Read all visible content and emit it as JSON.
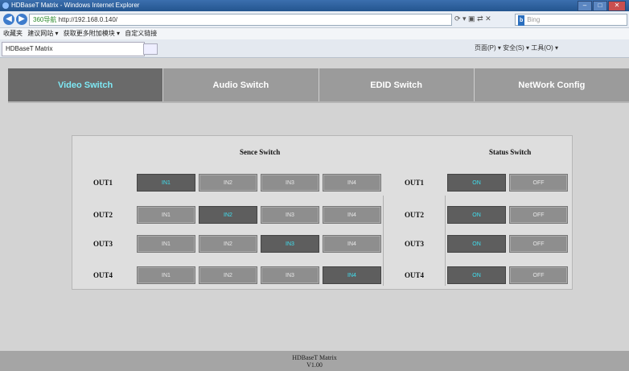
{
  "browser": {
    "window_title": "HDBaseT Matrix - Windows Internet Explorer",
    "url_prefix": "360导航",
    "url": "http://192.168.0.140/",
    "search_placeholder": "Bing",
    "search_engine_label": "Bing",
    "favorites_label": "收藏夹",
    "fav_links": [
      "建议网站 ▾",
      "获取更多附加模块 ▾",
      "自定义链接"
    ],
    "tab_title": "HDBaseT Matrix",
    "tools_text": "页面(P) ▾  安全(S) ▾  工具(O) ▾"
  },
  "nav": {
    "tabs": [
      "Video Switch",
      "Audio Switch",
      "EDID Switch",
      "NetWork Config"
    ],
    "active_index": 0
  },
  "panel": {
    "scene_header": "Sence Switch",
    "status_header": "Status Switch",
    "rows": [
      {
        "label": "OUT1",
        "active_input": 0,
        "status_label": "OUT1"
      },
      {
        "label": "OUT2",
        "active_input": 1,
        "status_label": "OUT2"
      },
      {
        "label": "OUT3",
        "active_input": 2,
        "status_label": "OUT3"
      },
      {
        "label": "OUT4",
        "active_input": 3,
        "status_label": "OUT4"
      }
    ],
    "inputs": [
      "IN1",
      "IN2",
      "IN3",
      "IN4"
    ],
    "on_label": "ON",
    "off_label": "OFF"
  },
  "footer": {
    "line1": "HDBaseT Matrix",
    "line2": "V1.00"
  },
  "colors": {
    "active_text": "#3fe0f0",
    "active_bg": "#5e5e5e",
    "button_bg": "#8e8e8e"
  }
}
